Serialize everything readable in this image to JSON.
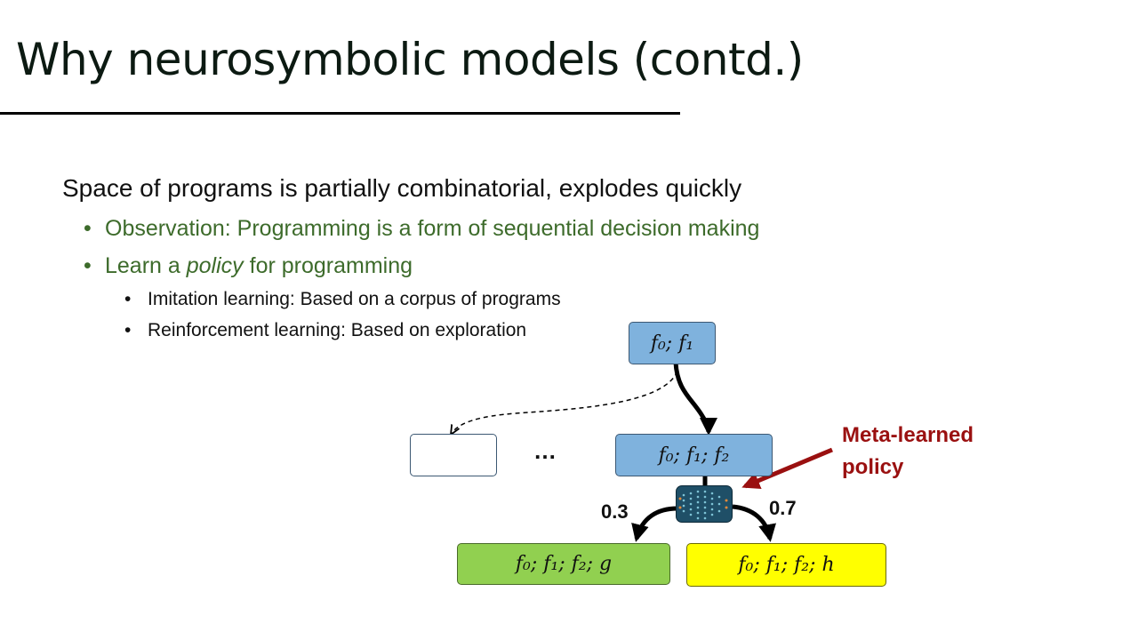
{
  "slide": {
    "title": "Why neurosymbolic models (contd.)",
    "body": {
      "main": "Space of programs is partially combinatorial, explodes quickly",
      "bullets": [
        {
          "text": "Observation: Programming is a form of sequential decision making"
        },
        {
          "prefix": "Learn a ",
          "emph": "policy",
          "suffix": " for programming"
        }
      ],
      "sub_bullets": [
        "Imitation learning: Based on a corpus of programs",
        "Reinforcement learning: Based on exploration"
      ],
      "bullet_glyph": "•"
    }
  },
  "diagram": {
    "nodes": {
      "root": "f₀; f₁",
      "middle": "f₀; f₁; f₂",
      "empty": "",
      "left_leaf": "f₀; f₁; f₂; g",
      "right_leaf": "f₀; f₁; f₂; h"
    },
    "ellipsis": "…",
    "probabilities": {
      "left": "0.3",
      "right": "0.7"
    },
    "policy_label": [
      "Meta-learned",
      "policy"
    ],
    "policy_icon": "neural-network-icon",
    "colors": {
      "node_blue": "#7fb2dd",
      "leaf_green": "#91d050",
      "leaf_yellow": "#ffff00",
      "accent_red": "#9a1010",
      "bullet_green": "#3d6b2b",
      "network": "#1f4f67"
    }
  }
}
